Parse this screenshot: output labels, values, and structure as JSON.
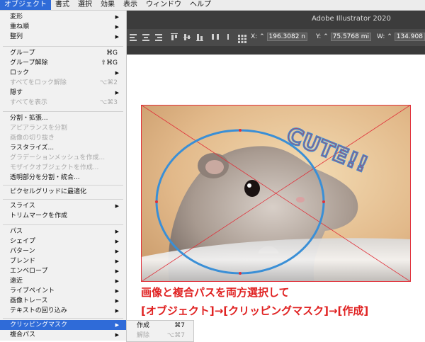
{
  "menubar": {
    "items": [
      "オブジェクト",
      "書式",
      "選択",
      "効果",
      "表示",
      "ウィンドウ",
      "ヘルプ"
    ]
  },
  "app": {
    "title": "Adobe Illustrator 2020",
    "x_label": "X:",
    "x_value": "196.3082 n",
    "y_label": "Y:",
    "y_value": "75.5768 mi",
    "w_label": "W:",
    "w_value": "134.908"
  },
  "menu": {
    "transform": "変形",
    "arrange": "重ね順",
    "align": "整列",
    "group": "グループ",
    "group_sc": "⌘G",
    "ungroup": "グループ解除",
    "ungroup_sc": "⇧⌘G",
    "lock": "ロック",
    "unlock_all": "すべてをロック解除",
    "unlock_all_sc": "⌥⌘2",
    "hide": "隠す",
    "show_all": "すべてを表示",
    "show_all_sc": "⌥⌘3",
    "expand": "分割・拡張...",
    "expand_appearance": "アピアランスを分割",
    "crop_image": "画像の切り抜き",
    "rasterize": "ラスタライズ...",
    "gradient_mesh": "グラデーションメッシュを作成...",
    "mosaic": "モザイクオブジェクトを作成...",
    "flatten_transparency": "透明部分を分割・統合...",
    "pixel_perfect": "ピクセルグリッドに最適化",
    "slice": "スライス",
    "trim_marks": "トリムマークを作成",
    "path": "パス",
    "shape": "シェイプ",
    "pattern": "パターン",
    "blend": "ブレンド",
    "envelope": "エンベロープ",
    "perspective": "遠近",
    "live_paint": "ライブペイント",
    "image_trace": "画像トレース",
    "text_wrap": "テキストの回り込み",
    "clipping_mask": "クリッピングマスク",
    "compound_path": "複合パス"
  },
  "submenu": {
    "make": "作成",
    "make_sc": "⌘7",
    "release": "解除",
    "release_sc": "⌥⌘7"
  },
  "artwork": {
    "stamp_text": "CUTE!!"
  },
  "caption": {
    "line1": "画像と複合パスを両方選択して",
    "line2": "[オブジェクト]→[クリッピングマスク]→[作成]"
  },
  "colors": {
    "menu_highlight": "#2f6bd8",
    "ellipse_stroke": "#3a8fd6",
    "selection": "#e0303a",
    "caption": "#e02222"
  }
}
